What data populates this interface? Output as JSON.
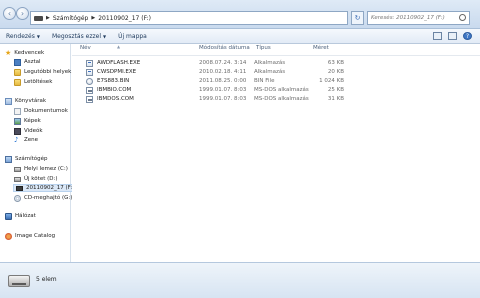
{
  "address": {
    "crumbs": [
      "Számítógép",
      "20110902_17 (F:)"
    ],
    "search_placeholder": "Keresés: 20110902_17 (F:)"
  },
  "toolbar": {
    "organize_label": "Rendezés",
    "share_label": "Megosztás ezzel",
    "new_folder_label": "Új mappa"
  },
  "nav": {
    "favorites": {
      "label": "Kedvencek",
      "items": [
        "Asztal",
        "Legutóbbi helyek",
        "Letöltések"
      ]
    },
    "libraries": {
      "label": "Könyvtárak",
      "items": [
        "Dokumentumok",
        "Képek",
        "Videók",
        "Zene"
      ]
    },
    "computer": {
      "label": "Számítógép",
      "items": [
        "Helyi lemez (C:)",
        "Új kötet (D:)",
        "20110902_17 (F:)",
        "CD-meghajtó (G:)"
      ]
    },
    "network": {
      "label": "Hálózat"
    },
    "image_catalog": {
      "label": "Image Catalog"
    }
  },
  "columns": {
    "name": "Név",
    "date": "Módosítás dátuma",
    "type": "Típus",
    "size": "Méret"
  },
  "files": [
    {
      "name": "AWDFLASH.EXE",
      "date": "2008.07.24. 3:14",
      "type": "Alkalmazás",
      "size": "63 KB",
      "icon": "exe-icon"
    },
    {
      "name": "CWSDPMI.EXE",
      "date": "2010.02.18. 4:11",
      "type": "Alkalmazás",
      "size": "20 KB",
      "icon": "exe-icon"
    },
    {
      "name": "E7S883.BIN",
      "date": "2011.08.25. 0:00",
      "type": "BIN File",
      "size": "1 024 KB",
      "icon": "bin-icon"
    },
    {
      "name": "IBMBIO.COM",
      "date": "1999.01.07. 8:03",
      "type": "MS-DOS alkalmazás",
      "size": "25 KB",
      "icon": "com-icon"
    },
    {
      "name": "IBMDOS.COM",
      "date": "1999.01.07. 8:03",
      "type": "MS-DOS alkalmazás",
      "size": "31 KB",
      "icon": "com-icon"
    }
  ],
  "status": {
    "item_count": "5 elem"
  }
}
